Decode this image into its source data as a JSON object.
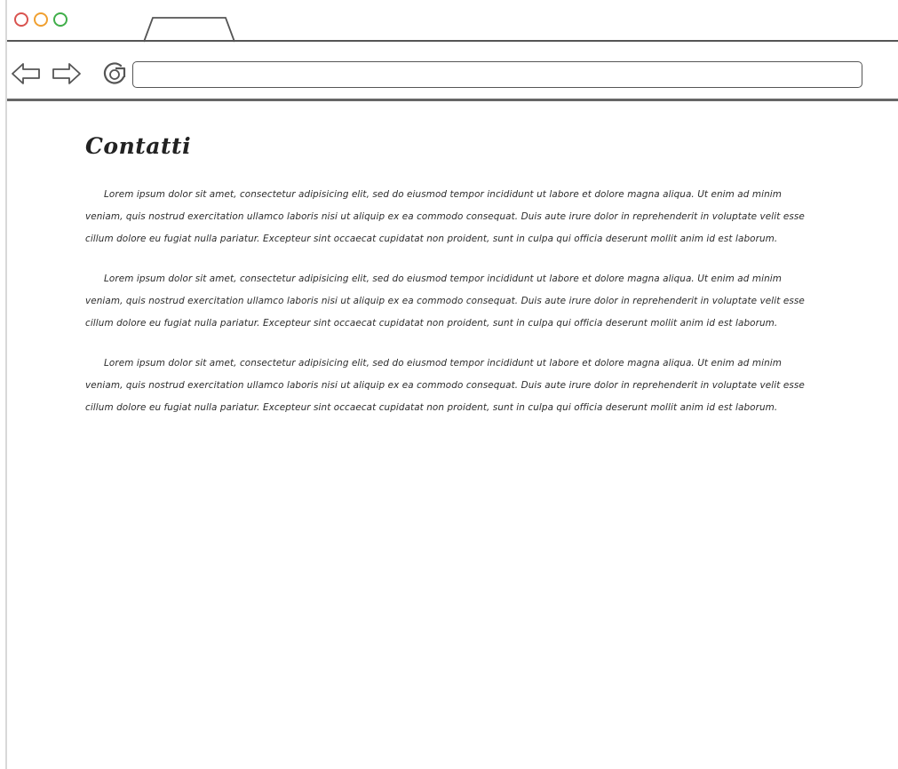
{
  "browser": {
    "tab": {
      "label": ""
    },
    "url": {
      "value": ""
    }
  },
  "page": {
    "title": "Contatti",
    "paragraphs": [
      "Lorem ipsum dolor sit amet, consectetur adipisicing elit, sed do eiusmod tempor incididunt ut labore et dolore magna aliqua. Ut enim ad minim veniam, quis nostrud exercitation ullamco laboris nisi ut aliquip ex ea commodo consequat. Duis aute irure dolor in reprehenderit in voluptate velit esse cillum dolore eu fugiat nulla pariatur. Excepteur sint occaecat cupidatat non proident, sunt in culpa qui officia deserunt mollit anim id est laborum.",
      "Lorem ipsum dolor sit amet, consectetur adipisicing elit, sed do eiusmod tempor incididunt ut labore et dolore magna aliqua. Ut enim ad minim veniam, quis nostrud exercitation ullamco laboris nisi ut aliquip ex ea commodo consequat. Duis aute irure dolor in reprehenderit in voluptate velit esse cillum dolore eu fugiat nulla pariatur. Excepteur sint occaecat cupidatat non proident, sunt in culpa qui officia deserunt mollit anim id est laborum.",
      "Lorem ipsum dolor sit amet, consectetur adipisicing elit, sed do eiusmod tempor incididunt ut labore et dolore magna aliqua. Ut enim ad minim veniam, quis nostrud exercitation ullamco laboris nisi ut aliquip ex ea commodo consequat. Duis aute irure dolor in reprehenderit in voluptate velit esse cillum dolore eu fugiat nulla pariatur. Excepteur sint occaecat cupidatat non proident, sunt in culpa qui officia deserunt mollit anim id est laborum."
    ]
  },
  "icons": {
    "close": "close-circle-icon",
    "minimize": "minimize-circle-icon",
    "maximize": "maximize-circle-icon",
    "back": "back-arrow-icon",
    "forward": "forward-arrow-icon",
    "reload": "reload-icon"
  },
  "colors": {
    "close": "#d9534f",
    "minimize": "#f0a030",
    "maximize": "#3fae49",
    "stroke": "#555555"
  }
}
